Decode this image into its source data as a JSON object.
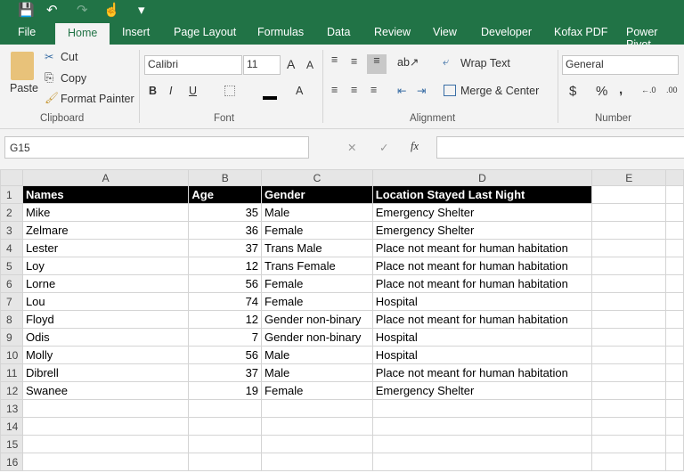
{
  "qat": {
    "save": "💾",
    "undo": "↶",
    "redo": "↷",
    "touch": "☝",
    "more": "▾"
  },
  "tabs": [
    "File",
    "Home",
    "Insert",
    "Page Layout",
    "Formulas",
    "Data",
    "Review",
    "View",
    "Developer",
    "Kofax PDF",
    "Power Pivot"
  ],
  "ribbon": {
    "paste": "Paste",
    "cut": "Cut",
    "copy": "Copy",
    "format_painter": "Format Painter",
    "clipboard": "Clipboard",
    "font_name": "Calibri",
    "font_size": "11",
    "font": "Font",
    "bold": "B",
    "italic": "I",
    "underline": "U",
    "wrap_text": "Wrap Text",
    "merge_center": "Merge & Center",
    "alignment": "Alignment",
    "number_format": "General",
    "currency": "$",
    "percent": "%",
    "comma": ",",
    "number": "Number"
  },
  "formula_bar": {
    "name_box": "G15",
    "fx": "fx",
    "cancel": "✕",
    "enter": "✓",
    "value": ""
  },
  "columns": [
    "A",
    "B",
    "C",
    "D",
    "E"
  ],
  "header": [
    "Names",
    "Age",
    "Gender",
    "Location Stayed Last Night"
  ],
  "rows": [
    [
      "Mike",
      "35",
      "Male",
      "Emergency Shelter"
    ],
    [
      "Zelmare",
      "36",
      "Female",
      "Emergency Shelter"
    ],
    [
      "Lester",
      "37",
      "Trans Male",
      "Place not meant for human habitation"
    ],
    [
      "Loy",
      "12",
      "Trans Female",
      "Place not meant for human habitation"
    ],
    [
      "Lorne",
      "56",
      "Female",
      "Place not meant for human habitation"
    ],
    [
      "Lou",
      "74",
      "Female",
      "Hospital"
    ],
    [
      "Floyd",
      "12",
      "Gender non-binary",
      "Place not meant for human habitation"
    ],
    [
      "Odis",
      "7",
      "Gender non-binary",
      "Hospital"
    ],
    [
      "Molly",
      "56",
      "Male",
      "Hospital"
    ],
    [
      "Dibrell",
      "37",
      "Male",
      "Place not meant for human habitation"
    ],
    [
      "Swanee",
      "19",
      "Female",
      "Emergency Shelter"
    ]
  ],
  "row_numbers": [
    "1",
    "2",
    "3",
    "4",
    "5",
    "6",
    "7",
    "8",
    "9",
    "10",
    "11",
    "12",
    "13",
    "14",
    "15",
    "16"
  ]
}
